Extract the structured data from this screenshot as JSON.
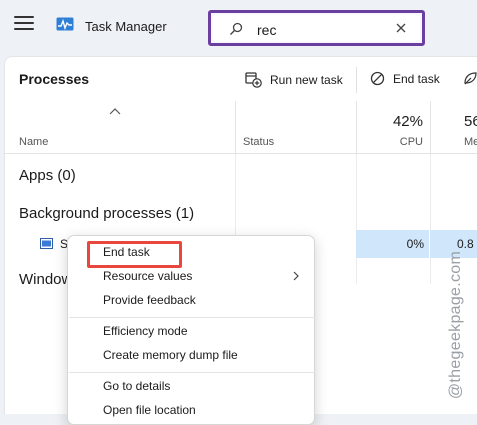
{
  "window": {
    "title": "Task Manager"
  },
  "search": {
    "query": "rec"
  },
  "toolbar": {
    "page_title": "Processes",
    "run_new_task": "Run new task",
    "end_task": "End task"
  },
  "columns": {
    "name": "Name",
    "status": "Status",
    "cpu_percent": "42%",
    "cpu": "CPU",
    "memory_percent": "56",
    "memory": "Mem"
  },
  "groups": {
    "apps": "Apps (0)",
    "background": "Background processes (1)",
    "windows": "Window"
  },
  "selected_row": {
    "name": "S",
    "cpu": "0%",
    "memory": "0.8"
  },
  "context_menu": {
    "items": [
      "End task",
      "Resource values",
      "Provide feedback",
      "Efficiency mode",
      "Create memory dump file",
      "Go to details",
      "Open file location"
    ]
  },
  "watermark": "@thegeekpage.com",
  "colors": {
    "search_highlight": "#6b3fa0",
    "end_task_highlight": "#e8473d",
    "selection": "#cfe6fb"
  }
}
